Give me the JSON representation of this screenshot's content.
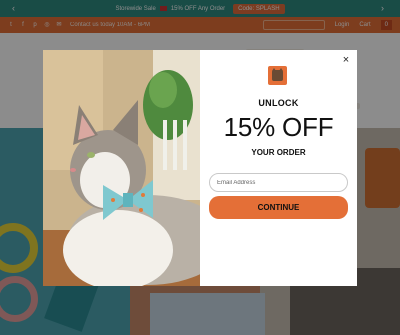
{
  "announcement": {
    "prev_icon": "chevron-left-icon",
    "next_icon": "chevron-right-icon",
    "text_before_flag": "Storewide Sale",
    "text_after_flag": "15% OFF Any Order",
    "code_label": "Code: SPLASH"
  },
  "topbar": {
    "social_icons": [
      "twitter-icon",
      "facebook-icon",
      "pinterest-icon",
      "instagram-icon",
      "email-icon"
    ],
    "contact_text": "Contact us today 10AM - 6PM",
    "links": [
      "Login",
      "Cart"
    ],
    "cart_count": "0"
  },
  "popup": {
    "close_icon": "×",
    "unlock": "UNLOCK",
    "offer": "15% OFF",
    "your_order": "YOUR ORDER",
    "email_placeholder": "Email Address",
    "email_value": "",
    "cta_label": "CONTINUE"
  },
  "colors": {
    "accent": "#e46f37",
    "announcement_bg": "#2f8a80",
    "overlay": "rgba(0,0,0,0.45)"
  }
}
